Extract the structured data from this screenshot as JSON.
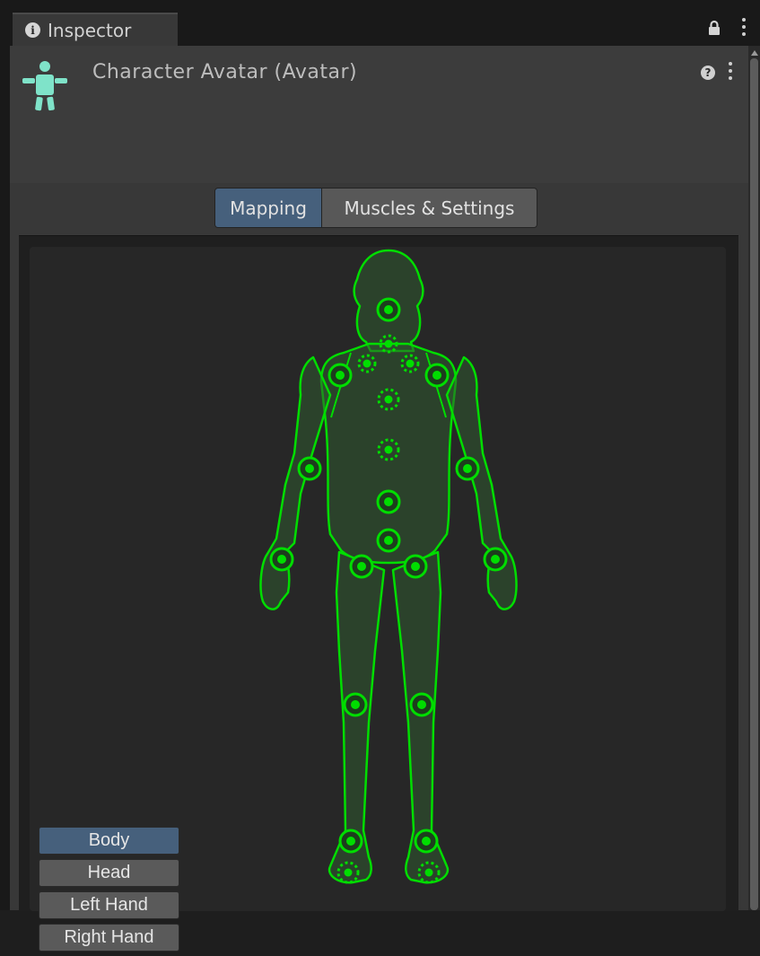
{
  "tab": {
    "label": "Inspector",
    "info_glyph": "i"
  },
  "header": {
    "title": "Character Avatar (Avatar)",
    "help_glyph": "?"
  },
  "tabs": [
    {
      "label": "Mapping",
      "active": true
    },
    {
      "label": "Muscles & Settings",
      "active": false
    }
  ],
  "body_parts": [
    {
      "label": "Body",
      "active": true
    },
    {
      "label": "Head",
      "active": false
    },
    {
      "label": "Left Hand",
      "active": false
    },
    {
      "label": "Right Hand",
      "active": false
    }
  ],
  "colors": {
    "accent_blue": "#46607c",
    "bone_green": "#00dd00",
    "avatar_icon": "#7fe3c9"
  },
  "icons": [
    "info-icon",
    "lock-icon",
    "menu-icon",
    "avatar-icon",
    "help-icon"
  ]
}
